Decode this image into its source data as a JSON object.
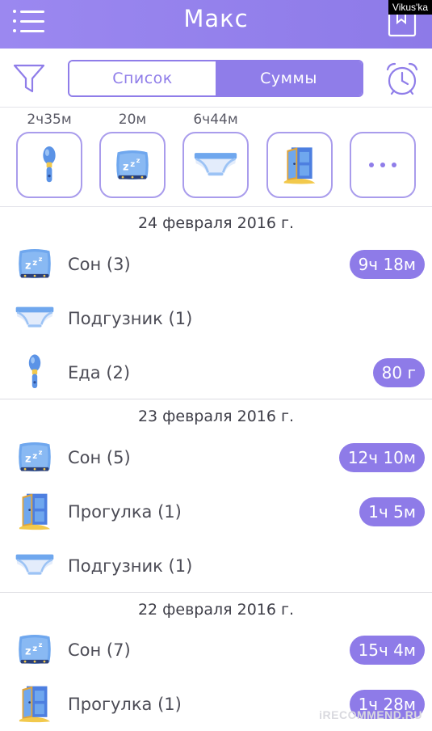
{
  "header": {
    "title": "Макс",
    "watermark": "Vikus'ka"
  },
  "filter": {
    "tabs": [
      {
        "label": "Список"
      },
      {
        "label": "Суммы"
      }
    ]
  },
  "quick": [
    {
      "label": "2ч35м",
      "icon": "feeding-spoon-icon"
    },
    {
      "label": "20м",
      "icon": "sleep-pillow-icon"
    },
    {
      "label": "6ч44м",
      "icon": "diaper-icon"
    },
    {
      "label": "",
      "icon": "door-walk-icon"
    },
    {
      "label": "",
      "icon": "more-dots-icon"
    }
  ],
  "days": [
    {
      "date": "24 февраля 2016 г.",
      "entries": [
        {
          "icon": "sleep-pillow-icon",
          "name": "Сон (3)",
          "total": "9ч 18м"
        },
        {
          "icon": "diaper-icon",
          "name": "Подгузник (1)",
          "total": ""
        },
        {
          "icon": "feeding-spoon-icon",
          "name": "Еда (2)",
          "total": "80 г"
        }
      ]
    },
    {
      "date": "23 февраля 2016 г.",
      "entries": [
        {
          "icon": "sleep-pillow-icon",
          "name": "Сон (5)",
          "total": "12ч 10м"
        },
        {
          "icon": "door-walk-icon",
          "name": "Прогулка (1)",
          "total": "1ч 5м"
        },
        {
          "icon": "diaper-icon",
          "name": "Подгузник (1)",
          "total": ""
        }
      ]
    },
    {
      "date": "22 февраля 2016 г.",
      "entries": [
        {
          "icon": "sleep-pillow-icon",
          "name": "Сон (7)",
          "total": "15ч 4м"
        },
        {
          "icon": "door-walk-icon",
          "name": "Прогулка (1)",
          "total": "1ч 28м"
        }
      ]
    }
  ],
  "footer": {
    "watermark": "iRECOMMEND.RU"
  },
  "colors": {
    "accent": "#8e7be8",
    "pillText": "#ffffff",
    "iconBlue": "#6fa7ee"
  }
}
